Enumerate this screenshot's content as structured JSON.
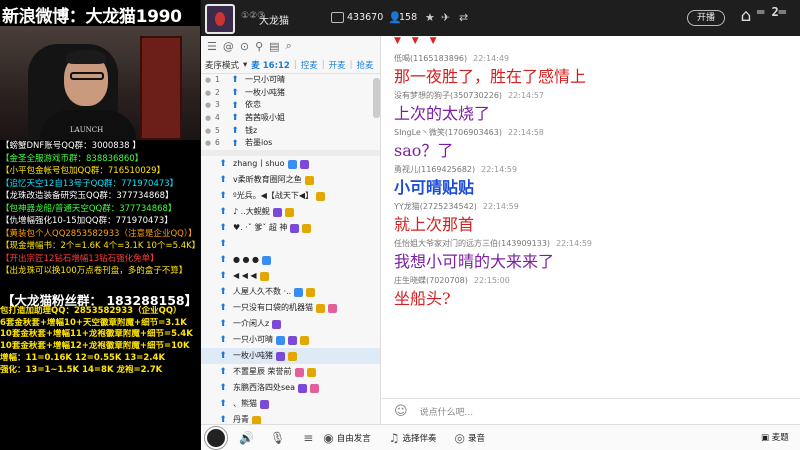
{
  "stream": {
    "title": "新浪微博：大龙猫1990",
    "shirt_text": "LAUNCH",
    "info_lines": [
      {
        "text": "【螃蟹DNF账号QQ群：3000838 】",
        "color": "c-white"
      },
      {
        "text": "【金圣全服游戏币群：838836860】",
        "color": "c-green"
      },
      {
        "text": "【小平包金帐号包加QQ群：716510029】",
        "color": "c-yellow"
      },
      {
        "text": "【追忆天空12自13号子QQ群：771970473】",
        "color": "c-cyan"
      },
      {
        "text": "【龙珠改造装备研究玉QQ群：377734868】",
        "color": "c-white"
      },
      {
        "text": "【包神器龙船/普通天空QQ群：377734868】",
        "color": "c-green"
      },
      {
        "text": "【仇增幅强化10-15加QQ群：771970473】",
        "color": "c-white"
      },
      {
        "text": "【黄装包个人QQ2853582933（注意是企业QQ）】",
        "color": "c-orange"
      },
      {
        "text": "【现金增幅书：2个=1.6K  4个=3.1K 10个=5.4K】",
        "color": "c-yellow"
      },
      {
        "text": "【开出宗匠12钻石增幅13钻石强化免单】",
        "color": "c-red"
      },
      {
        "text": "【出龙珠可以换100万点卷刊盘，多的盒子不算】",
        "color": "c-yellow"
      }
    ],
    "fan_group": "【大龙猫粉丝群： 183288158】",
    "price_lines": [
      "包打造加助理QQ：2853582933（企业QQ）",
      "6套金秋套+增幅10+天空徽章附魔+细节=3.1K",
      "10套金秋套+增幅11+龙袍徽章附魔+细节=5.4K",
      "10套金秋套+增幅12+龙袍徽章附魔+细节=10K",
      "增幅：11=0.16K  12=0.55K  13=2.4K",
      "强化：13=1~1.5K  14=8K  龙袍=2.7K"
    ]
  },
  "topbar": {
    "room_prefix": "①②③",
    "room_name": "大龙猫",
    "viewer_count": "433670",
    "fans_count": "158",
    "follow_label": "开播",
    "home_icon": "home-icon",
    "logo_text": "═ 2═"
  },
  "userlist": {
    "mode_label": "麦序模式",
    "mic_time": "麦 16:12",
    "tabs": [
      "控麦",
      "开麦",
      "抢麦"
    ],
    "mic_rows": [
      {
        "num": "1",
        "name": "一只小可晴"
      },
      {
        "num": "2",
        "name": "一枚小吨猪"
      },
      {
        "num": "3",
        "name": "依恋"
      },
      {
        "num": "4",
        "name": "茜茜吸小姐"
      },
      {
        "num": "5",
        "name": "钱z"
      },
      {
        "num": "6",
        "name": "若墨ios"
      }
    ],
    "users": [
      {
        "name": "zhang丨shuo",
        "sel": false,
        "badges": [
          "b-blue",
          "b-purple"
        ]
      },
      {
        "name": "v柔昕教育圈阿之鱼",
        "sel": false,
        "badges": [
          "b-gold"
        ]
      },
      {
        "name": "º光兵。◀【战天下◀】",
        "sel": false,
        "badges": [
          "b-gold"
        ]
      },
      {
        "name": "♪  ..大鲵鲵",
        "sel": false,
        "badges": [
          "b-purple",
          "b-gold"
        ]
      },
      {
        "name": "♥.  ·ˇ 爹ˇ 超  神",
        "sel": false,
        "badges": [
          "b-purple",
          "b-gold"
        ]
      },
      {
        "name": "",
        "sel": false,
        "badges": []
      },
      {
        "name": "● ● ●",
        "sel": false,
        "badges": [
          "b-blue"
        ]
      },
      {
        "name": "◀  ◀  ◀",
        "sel": false,
        "badges": [
          "b-gold"
        ]
      },
      {
        "name": "人屋人久不数 ·..",
        "sel": false,
        "badges": [
          "b-blue",
          "b-gold"
        ]
      },
      {
        "name": "一只没有口袋的机器猫",
        "sel": false,
        "badges": [
          "b-gold",
          "b-pink"
        ]
      },
      {
        "name": "一介闲人z",
        "sel": false,
        "badges": [
          "b-purple"
        ]
      },
      {
        "name": "一只小可晴",
        "sel": false,
        "badges": [
          "b-blue",
          "b-purple",
          "b-gold"
        ]
      },
      {
        "name": "一枚小吨猪",
        "sel": true,
        "badges": [
          "b-purple",
          "b-gold"
        ]
      },
      {
        "name": "不置星辰  荣誉前",
        "sel": false,
        "badges": [
          "b-pink",
          "b-gold"
        ]
      },
      {
        "name": "东鹏西洛四处sea",
        "sel": false,
        "badges": [
          "b-purple",
          "b-pink"
        ]
      },
      {
        "name": "、熊猫",
        "sel": false,
        "badges": [
          "b-purple"
        ]
      },
      {
        "name": "丹青",
        "sel": false,
        "badges": [
          "b-gold"
        ]
      }
    ],
    "bottom_labels": {
      "free_talk": "自由发言",
      "choose_music": "选择伴奏",
      "record": "录音",
      "mic_switch": "麦题"
    }
  },
  "chat": {
    "top_marks": "▼ ▼ ▼",
    "messages": [
      {
        "user": "低喝(1165183896)",
        "time": "22:14:49",
        "text": "那一夜胜了，胜在了感情上",
        "style": "t-red"
      },
      {
        "user": "没有梦想的狗子(350730226)",
        "time": "22:14:57",
        "text": "上次的太烧了",
        "style": "t-purple"
      },
      {
        "user": "SIngLe丶微笑(1706903463)",
        "time": "22:14:58",
        "text": "sao？了",
        "style": "t-purple"
      },
      {
        "user": "勇视儿(1169425682)",
        "time": "22:14:59",
        "text": "小可晴贴贴",
        "style": "t-blue t-bold"
      },
      {
        "user": "YY龙猫(2725234542)",
        "time": "22:14:59",
        "text": "就上次那首",
        "style": "t-red"
      },
      {
        "user": "任怡姐大爷家对门的远方三伯(143909133)",
        "time": "22:14:59",
        "text": "我想小可晴的大来来了",
        "style": "t-purple"
      },
      {
        "user": "庄生晓蝶(7020708)",
        "time": "22:15:00",
        "text": "坐船头?",
        "style": "t-red"
      }
    ],
    "input_placeholder": "说点什么吧..."
  }
}
